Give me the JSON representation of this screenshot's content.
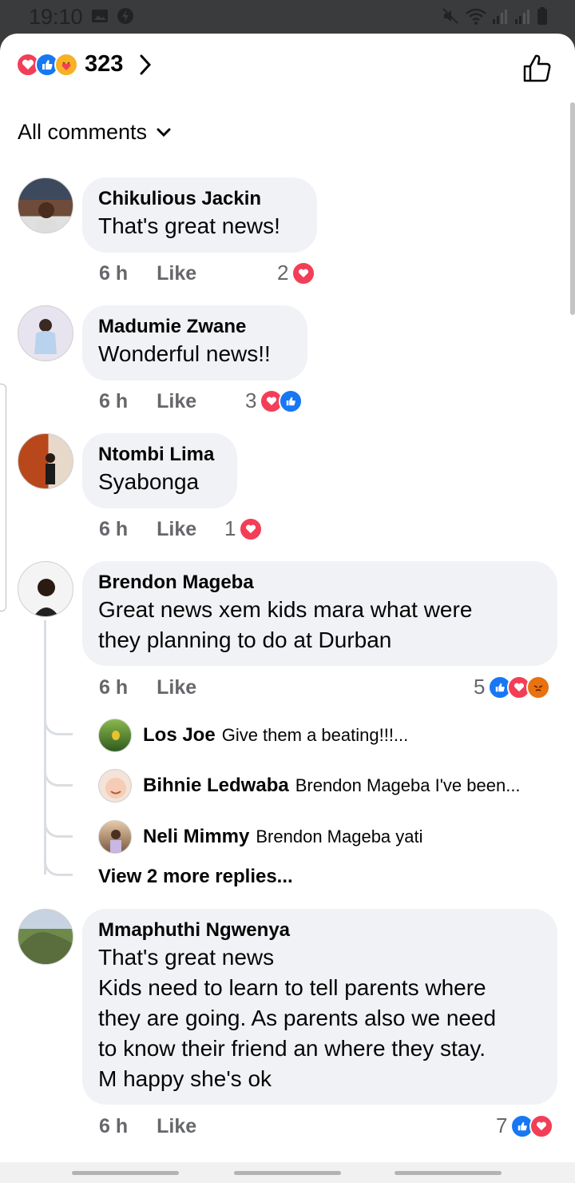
{
  "status_bar": {
    "time": "19:10"
  },
  "header": {
    "reaction_count": "323"
  },
  "filter": {
    "label": "All comments"
  },
  "comments": [
    {
      "name": "Chikulious Jackin",
      "text": "That's great news!",
      "time": "6 h",
      "like_label": "Like",
      "reaction_count": "2",
      "reactions": [
        "love"
      ]
    },
    {
      "name": "Madumie Zwane",
      "text": "Wonderful news!!",
      "time": "6 h",
      "like_label": "Like",
      "reaction_count": "3",
      "reactions": [
        "love",
        "like"
      ]
    },
    {
      "name": "Ntombi Lima",
      "text": "Syabonga",
      "time": "6 h",
      "like_label": "Like",
      "reaction_count": "1",
      "reactions": [
        "love"
      ]
    },
    {
      "name": "Brendon Mageba",
      "text_line1": "Great news xem kids mara what were",
      "text_line2": "they planning to do at Durban",
      "time": "6 h",
      "like_label": "Like",
      "reaction_count": "5",
      "reactions": [
        "like",
        "love",
        "angry"
      ]
    },
    {
      "name": "Mmaphuthi Ngwenya",
      "text_lines": [
        "That's great news",
        "Kids need to learn to tell parents where",
        "they are going. As parents also we need",
        "to know their friend an where they stay.",
        "M happy she's ok"
      ],
      "time": "6 h",
      "like_label": "Like",
      "reaction_count": "7",
      "reactions": [
        "like",
        "love"
      ]
    }
  ],
  "replies": [
    {
      "name": "Los Joe",
      "text": "Give them a beating!!!..."
    },
    {
      "name": "Bihnie Ledwaba",
      "text": "Brendon Mageba I've been..."
    },
    {
      "name": "Neli Mimmy",
      "text": "Brendon Mageba yati"
    }
  ],
  "view_more_replies": "View 2 more replies...",
  "colors": {
    "like_blue": "#1877f2",
    "love_red": "#f33e58",
    "angry_orange": "#e9710f",
    "bubble_bg": "#f0f2f5",
    "meta_gray": "#65676b"
  },
  "icons": [
    "gallery-icon",
    "notification-icon",
    "mute-icon",
    "wifi-icon",
    "signal-icon",
    "battery-icon",
    "love-reaction-icon",
    "like-reaction-icon",
    "care-reaction-icon",
    "angry-reaction-icon",
    "chevron-right-icon",
    "thumbs-up-icon",
    "chevron-down-icon"
  ]
}
